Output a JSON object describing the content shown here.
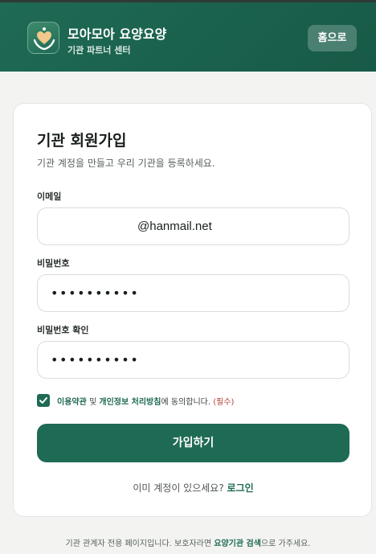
{
  "header": {
    "brand_title": "모아모아 요양요양",
    "brand_subtitle": "기관 파트너 센터",
    "logo_icon": "heart-hands-icon",
    "home_button": "홈으로"
  },
  "signup": {
    "title": "기관 회원가입",
    "subtitle": "기관 계정을 만들고 우리 기관을 등록하세요.",
    "email_label": "이메일",
    "email_value": "@hanmail.net",
    "password_label": "비밀번호",
    "password_value": "••••••••••",
    "password_confirm_label": "비밀번호 확인",
    "password_confirm_value": "••••••••••",
    "agree": {
      "checked": true,
      "terms_link": "이용약관",
      "and": " 및 ",
      "privacy_link": "개인정보 처리방침",
      "suffix": "에 동의합니다. ",
      "required": "(필수)"
    },
    "submit_button": "가입하기",
    "login_prompt": "이미 계정이 있으세요? ",
    "login_link": "로그인"
  },
  "footer": {
    "prefix": "기관 관계자 전용 페이지입니다. 보호자라면 ",
    "link": "요양기관 검색",
    "suffix": "으로 가주세요."
  },
  "colors": {
    "brand": "#1f6a55",
    "required": "#b0423a"
  }
}
